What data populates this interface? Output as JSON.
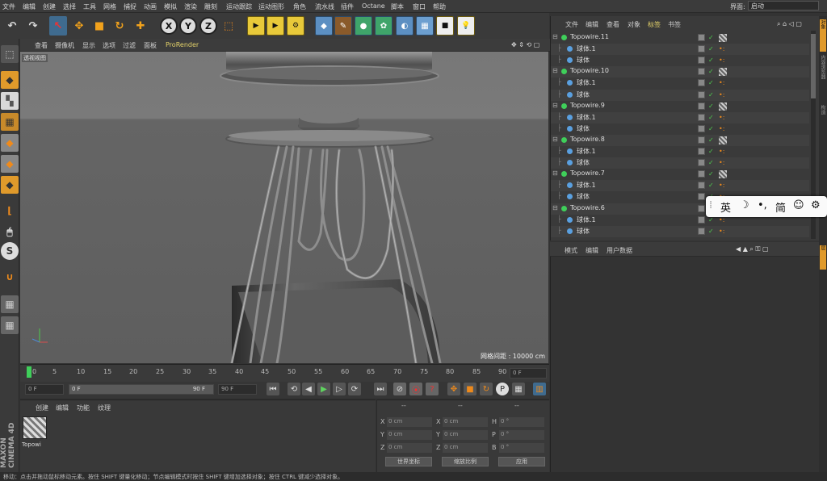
{
  "menu": {
    "items": [
      "文件",
      "编辑",
      "创建",
      "选择",
      "工具",
      "网格",
      "捕捉",
      "动画",
      "模拟",
      "渲染",
      "雕刻",
      "运动跟踪",
      "运动图形",
      "角色",
      "流水线",
      "插件",
      "Octane",
      "脚本",
      "窗口",
      "帮助"
    ],
    "layout_label": "界面:",
    "layout_value": "启动"
  },
  "toolbar": {
    "x_label": "X",
    "y_label": "Y",
    "z_label": "Z"
  },
  "viewport": {
    "menu": [
      "查看",
      "摄像机",
      "显示",
      "选项",
      "过滤",
      "面板",
      "ProRender"
    ],
    "label": "透视视图",
    "grid_spacing": "网格间距 : 10000 cm"
  },
  "timeline": {
    "ticks": [
      "0",
      "5",
      "10",
      "15",
      "20",
      "25",
      "30",
      "35",
      "40",
      "45",
      "50",
      "55",
      "60",
      "65",
      "70",
      "75",
      "80",
      "85",
      "90"
    ],
    "current_frame": "0 F"
  },
  "transport": {
    "start": "0 F",
    "range_start": "0 F",
    "range_end": "90 F",
    "end": "90 F"
  },
  "material": {
    "menu": [
      "创建",
      "编辑",
      "功能",
      "纹理"
    ],
    "item_label": "Topowi"
  },
  "coords": {
    "header_a": "--",
    "header_b": "--",
    "header_c": "--",
    "rows": [
      {
        "a": "X",
        "av": "0 cm",
        "b": "X",
        "bv": "0 cm",
        "c": "H",
        "cv": "0 °"
      },
      {
        "a": "Y",
        "av": "0 cm",
        "b": "Y",
        "bv": "0 cm",
        "c": "P",
        "cv": "0 °"
      },
      {
        "a": "Z",
        "av": "0 cm",
        "b": "Z",
        "bv": "0 cm",
        "c": "B",
        "cv": "0 °"
      }
    ],
    "world": "世界坐标",
    "scale": "缩放比例",
    "apply": "应用"
  },
  "objects": {
    "menu": [
      "文件",
      "编辑",
      "查看",
      "对象",
      "标签",
      "书签"
    ],
    "items": [
      {
        "name": "Topowire.11",
        "level": 0
      },
      {
        "name": "球体.1",
        "level": 1
      },
      {
        "name": "球体",
        "level": 1
      },
      {
        "name": "Topowire.10",
        "level": 0
      },
      {
        "name": "球体.1",
        "level": 1
      },
      {
        "name": "球体",
        "level": 1
      },
      {
        "name": "Topowire.9",
        "level": 0
      },
      {
        "name": "球体.1",
        "level": 1
      },
      {
        "name": "球体",
        "level": 1
      },
      {
        "name": "Topowire.8",
        "level": 0
      },
      {
        "name": "球体.1",
        "level": 1
      },
      {
        "name": "球体",
        "level": 1
      },
      {
        "name": "Topowire.7",
        "level": 0
      },
      {
        "name": "球体.1",
        "level": 1
      },
      {
        "name": "球体",
        "level": 1
      },
      {
        "name": "Topowire.6",
        "level": 0
      },
      {
        "name": "球体.1",
        "level": 1
      },
      {
        "name": "球体",
        "level": 1
      }
    ]
  },
  "attributes": {
    "menu": [
      "模式",
      "编辑",
      "用户数据"
    ]
  },
  "ime": {
    "lang": "英",
    "mode": "简"
  },
  "brand": "MAXON CINEMA 4D",
  "status": "移动：点击并拖动鼠标移动元素。按住 SHIFT 键量化移动；节点编辑模式时按住 SHIFT 键增加选择对象；按住 CTRL 键减少选择对象。",
  "right_tabs": [
    "对象",
    "内容浏览器",
    "构造",
    "层"
  ]
}
